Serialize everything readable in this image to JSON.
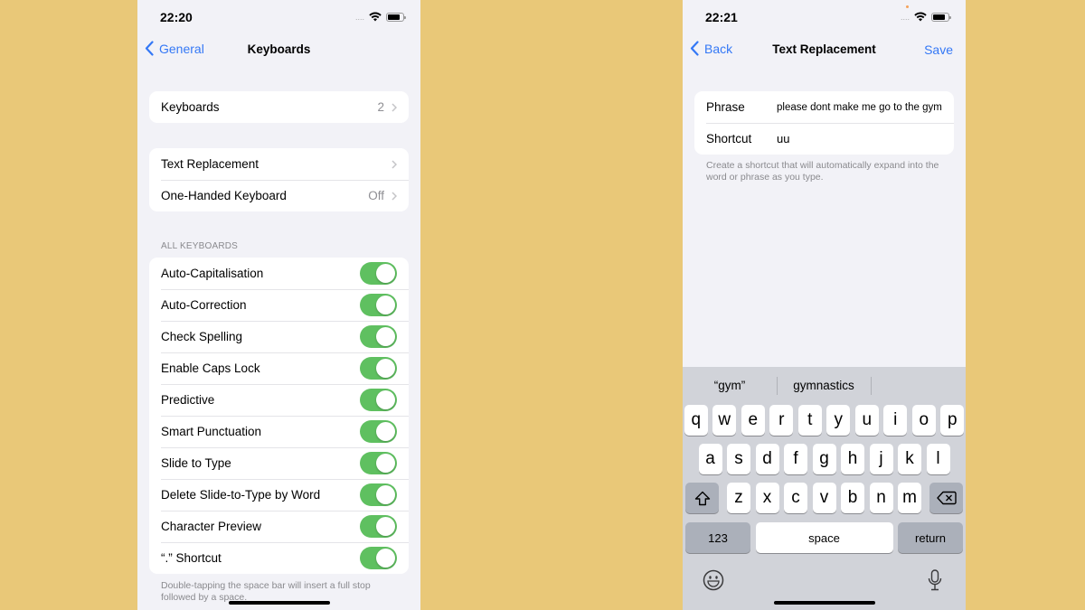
{
  "colors": {
    "background": "#e9c878",
    "accent": "#3478f6",
    "toggle_on": "#5fc060",
    "screen_bg": "#f2f2f7",
    "keyboard_bg": "#d1d3d9"
  },
  "left_screen": {
    "status": {
      "time": "22:20",
      "signal": "....",
      "wifi_icon": "wifi-icon",
      "battery_icon": "battery-icon"
    },
    "nav": {
      "back_label": "General",
      "title": "Keyboards"
    },
    "group1": [
      {
        "label": "Keyboards",
        "value": "2"
      }
    ],
    "group2": [
      {
        "label": "Text Replacement",
        "value": ""
      },
      {
        "label": "One-Handed Keyboard",
        "value": "Off"
      }
    ],
    "section_header": "ALL KEYBOARDS",
    "toggles": [
      {
        "label": "Auto-Capitalisation",
        "on": true
      },
      {
        "label": "Auto-Correction",
        "on": true
      },
      {
        "label": "Check Spelling",
        "on": true
      },
      {
        "label": "Enable Caps Lock",
        "on": true
      },
      {
        "label": "Predictive",
        "on": true
      },
      {
        "label": "Smart Punctuation",
        "on": true
      },
      {
        "label": "Slide to Type",
        "on": true
      },
      {
        "label": "Delete Slide-to-Type by Word",
        "on": true
      },
      {
        "label": "Character Preview",
        "on": true
      },
      {
        "label": "“.” Shortcut",
        "on": true
      }
    ],
    "footnote": "Double-tapping the space bar will insert a full stop followed by a space."
  },
  "right_screen": {
    "status": {
      "time": "22:21",
      "signal": "....",
      "wifi_icon": "wifi-icon",
      "battery_icon": "battery-icon"
    },
    "nav": {
      "back_label": "Back",
      "title": "Text Replacement",
      "action_label": "Save"
    },
    "fields": {
      "phrase_label": "Phrase",
      "phrase_value": "please dont make me go to the gym",
      "shortcut_label": "Shortcut",
      "shortcut_value": "uu"
    },
    "footnote": "Create a shortcut that will automatically expand into the word or phrase as you type.",
    "keyboard": {
      "suggestions": [
        "“gym”",
        "gymnastics",
        ""
      ],
      "row1": [
        "q",
        "w",
        "e",
        "r",
        "t",
        "y",
        "u",
        "i",
        "o",
        "p"
      ],
      "row2": [
        "a",
        "s",
        "d",
        "f",
        "g",
        "h",
        "j",
        "k",
        "l"
      ],
      "row3": [
        "z",
        "x",
        "c",
        "v",
        "b",
        "n",
        "m"
      ],
      "numbers_label": "123",
      "space_label": "space",
      "return_label": "return"
    }
  }
}
